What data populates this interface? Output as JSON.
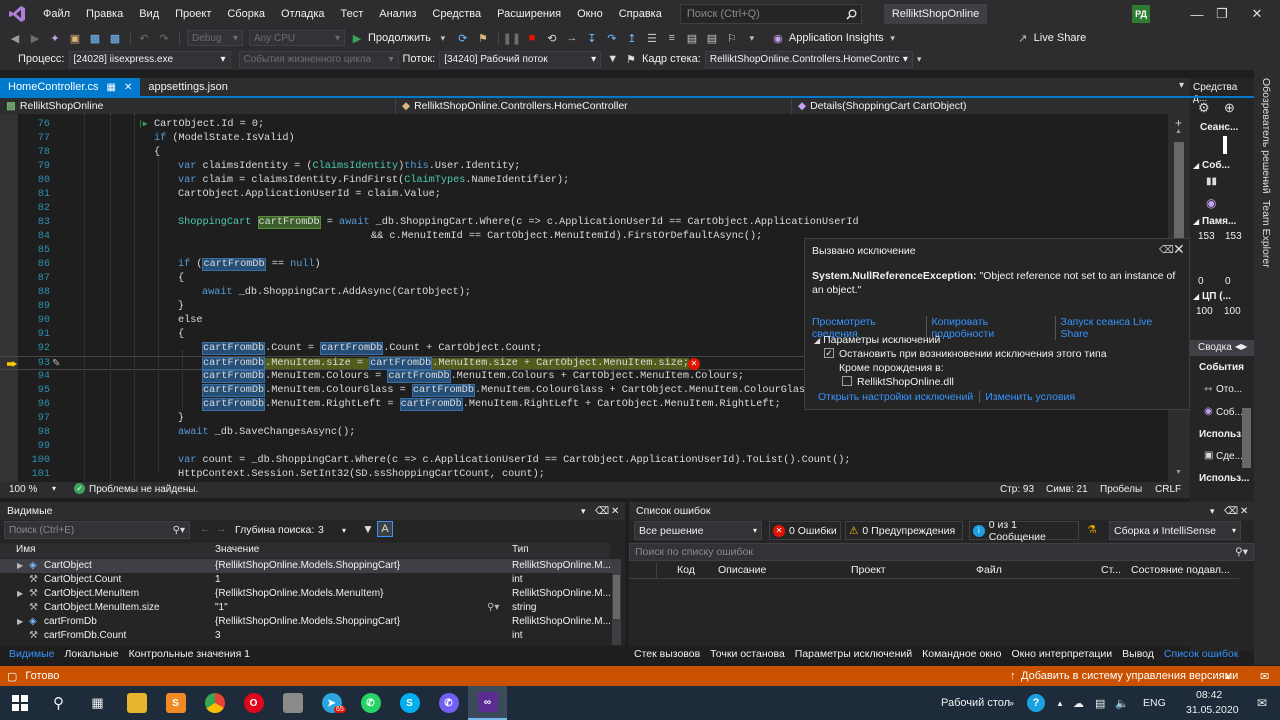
{
  "menu": {
    "items": [
      "Файл",
      "Правка",
      "Вид",
      "Проект",
      "Сборка",
      "Отладка",
      "Тест",
      "Анализ",
      "Средства",
      "Расширения",
      "Окно",
      "Справка"
    ],
    "search_placeholder": "Поиск (Ctrl+Q)",
    "solution_title": "RelliktShopOnline",
    "user_initials": "РД"
  },
  "toolbar": {
    "config": "Debug",
    "platform": "Any CPU",
    "continue_label": "Продолжить",
    "app_insights": "Application Insights",
    "live_share": "Live Share"
  },
  "debugbar": {
    "process_label": "Процесс:",
    "process_value": "[24028] iisexpress.exe",
    "lifecycle": "События жизненного цикла",
    "thread_label": "Поток:",
    "thread_value": "[34240] Рабочий поток",
    "frame_label": "Кадр стека:",
    "frame_value": "RelliktShopOnline.Controllers.HomeContrc"
  },
  "tabs": [
    {
      "label": "HomeController.cs",
      "active": true
    },
    {
      "label": "appsettings.json",
      "active": false
    }
  ],
  "navbar": {
    "project": "RelliktShopOnline",
    "class": "RelliktShopOnline.Controllers.HomeController",
    "method": "Details(ShoppingCart CartObject)"
  },
  "code_lines": [
    {
      "n": "76",
      "t": "CartObject.Id = 0;"
    },
    {
      "n": "77",
      "t": "if (ModelState.IsValid)"
    },
    {
      "n": "78",
      "t": "{"
    },
    {
      "n": "79",
      "t": "var claimsIdentity = (ClaimsIdentity)this.User.Identity;"
    },
    {
      "n": "80",
      "t": "var claim = claimsIdentity.FindFirst(ClaimTypes.NameIdentifier);"
    },
    {
      "n": "81",
      "t": "CartObject.ApplicationUserId = claim.Value;"
    },
    {
      "n": "82",
      "t": ""
    },
    {
      "n": "83",
      "t": "ShoppingCart cartFromDb = await _db.ShoppingCart.Where(c => c.ApplicationUserId == CartObject.ApplicationUserId"
    },
    {
      "n": "84",
      "t": "&& c.MenuItemId == CartObject.MenuItemId).FirstOrDefaultAsync();"
    },
    {
      "n": "85",
      "t": ""
    },
    {
      "n": "86",
      "t": "if (cartFromDb == null)"
    },
    {
      "n": "87",
      "t": "{"
    },
    {
      "n": "88",
      "t": "await _db.ShoppingCart.AddAsync(CartObject);"
    },
    {
      "n": "89",
      "t": "}"
    },
    {
      "n": "90",
      "t": "else"
    },
    {
      "n": "91",
      "t": "{"
    },
    {
      "n": "92",
      "t": "cartFromDb.Count = cartFromDb.Count + CartObject.Count;"
    },
    {
      "n": "93",
      "t": "cartFromDb.MenuItem.size = cartFromDb.MenuItem.size + CartObject.MenuItem.size;"
    },
    {
      "n": "94",
      "t": "cartFromDb.MenuItem.Colours = cartFromDb.MenuItem.Colours + CartObject.MenuItem.Colours;"
    },
    {
      "n": "95",
      "t": "cartFromDb.MenuItem.ColourGlass = cartFromDb.MenuItem.ColourGlass + CartObject.MenuItem.ColourGlass;"
    },
    {
      "n": "96",
      "t": "cartFromDb.MenuItem.RightLeft = cartFromDb.MenuItem.RightLeft + CartObject.MenuItem.RightLeft;"
    },
    {
      "n": "97",
      "t": "}"
    },
    {
      "n": "98",
      "t": "await _db.SaveChangesAsync();"
    },
    {
      "n": "99",
      "t": ""
    },
    {
      "n": "100",
      "t": "var count = _db.ShoppingCart.Where(c => c.ApplicationUserId == CartObject.ApplicationUserId).ToList().Count();"
    },
    {
      "n": "101",
      "t": "HttpContext.Session.SetInt32(SD.ssShoppingCartCount, count);"
    }
  ],
  "exception": {
    "header": "Вызвано исключение",
    "type": "System.NullReferenceException:",
    "message": "\"Object reference not set to an instance of an object.\"",
    "links": [
      "Просмотреть сведения",
      "Копировать подробности",
      "Запуск сеанса Live Share"
    ],
    "settings_title": "Параметры исключений",
    "break_option": "Остановить при возникновении исключения этого типа",
    "except_label": "Кроме порождения в:",
    "dll": "RelliktShopOnline.dll",
    "bottom_links": [
      "Открыть настройки исключений",
      "Изменить условия"
    ]
  },
  "editor_status": {
    "zoom": "100 %",
    "problems": "Проблемы не найдены.",
    "line": "Стр: 93",
    "col": "Симв: 21",
    "spaces": "Пробелы",
    "eol": "CRLF"
  },
  "locals": {
    "title": "Видимые",
    "search_placeholder": "Поиск (Ctrl+E)",
    "depth_label": "Глубина поиска:",
    "depth_value": "3",
    "columns": [
      "Имя",
      "Значение",
      "Тип"
    ],
    "rows": [
      {
        "name": "CartObject",
        "value": "{RelliktShopOnline.Models.ShoppingCart}",
        "type": "RelliktShopOnline.M..."
      },
      {
        "name": "CartObject.Count",
        "value": "1",
        "type": "int"
      },
      {
        "name": "CartObject.MenuItem",
        "value": "{RelliktShopOnline.Models.MenuItem}",
        "type": "RelliktShopOnline.M..."
      },
      {
        "name": "CartObject.MenuItem.size",
        "value": "\"1\"",
        "type": "string"
      },
      {
        "name": "cartFromDb",
        "value": "{RelliktShopOnline.Models.ShoppingCart}",
        "type": "RelliktShopOnline.M..."
      },
      {
        "name": "cartFromDb.Count",
        "value": "3",
        "type": "int"
      }
    ],
    "tabs": [
      "Видимые",
      "Локальные",
      "Контрольные значения 1"
    ]
  },
  "errorlist": {
    "title": "Список ошибок",
    "scope": "Все решение",
    "errors": "0 Ошибки",
    "warnings": "0 Предупреждения",
    "messages": "0 из 1 Сообщение",
    "build_filter": "Сборка и IntelliSense",
    "search_placeholder": "Поиск по списку ошибок",
    "columns": [
      "Код",
      "Описание",
      "Проект",
      "Файл",
      "Ст...",
      "Состояние подавл..."
    ],
    "tabs": [
      "Стек вызовов",
      "Точки останова",
      "Параметры исключений",
      "Командное окно",
      "Окно интерпретации",
      "Вывод",
      "Список ошибок"
    ]
  },
  "right_panel": {
    "title": "Средства д...",
    "session": "Сеанс...",
    "events": "Соб...",
    "memory": "Памя...",
    "mem_a": "153",
    "mem_b": "153",
    "zero_a": "0",
    "zero_b": "0",
    "cpu": "ЦП (...",
    "cpu_a": "100",
    "cpu_b": "100",
    "summary": "Сводка",
    "events2": "События",
    "item1": "Ото...",
    "item2": "Соб...",
    "use1": "Использ...",
    "item3": "Сде...",
    "use2": "Использ..."
  },
  "vertical_tabs": [
    "Обозреватель решений",
    "Team Explorer"
  ],
  "status": {
    "ready": "Готово",
    "source_control": "Добавить в систему управления версиями"
  },
  "taskbar": {
    "desktop": "Рабочий стол",
    "lang": "ENG",
    "time": "08:42",
    "date": "31.05.2020",
    "badge": "65"
  }
}
